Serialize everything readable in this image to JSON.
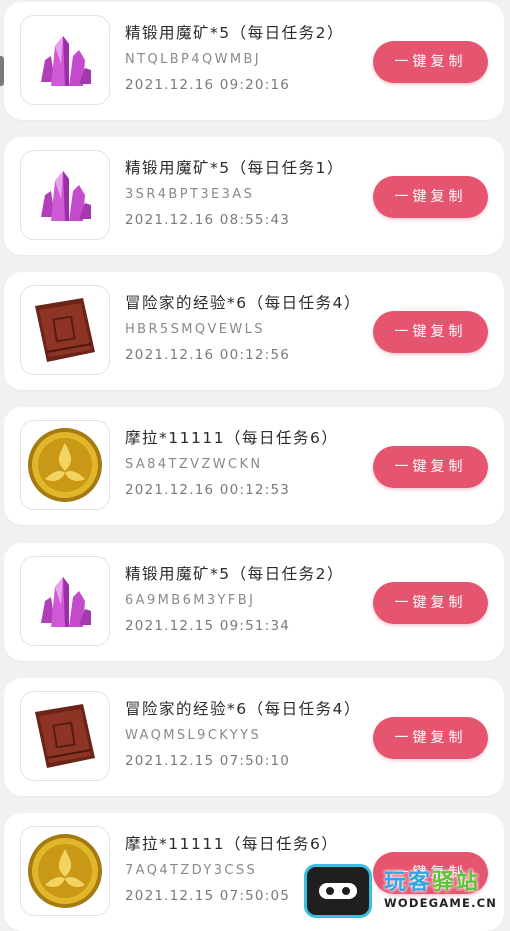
{
  "copy_label": "一键复制",
  "items": [
    {
      "title": "精锻用魔矿*5（每日任务2）",
      "code": "NTQLBP4QWMBJ",
      "time": "2021.12.16 09:20:16",
      "icon": "crystal-icon"
    },
    {
      "title": "精锻用魔矿*5（每日任务1）",
      "code": "3SR4BPT3E3AS",
      "time": "2021.12.16 08:55:43",
      "icon": "crystal-icon"
    },
    {
      "title": "冒险家的经验*6（每日任务4）",
      "code": "HBR5SMQVEWLS",
      "time": "2021.12.16 00:12:56",
      "icon": "book-icon"
    },
    {
      "title": "摩拉*11111（每日任务6）",
      "code": "SA84TZVZWCKN",
      "time": "2021.12.16 00:12:53",
      "icon": "coin-icon"
    },
    {
      "title": "精锻用魔矿*5（每日任务2）",
      "code": "6A9MB6M3YFBJ",
      "time": "2021.12.15 09:51:34",
      "icon": "crystal-icon"
    },
    {
      "title": "冒险家的经验*6（每日任务4）",
      "code": "WAQMSL9CKYYS",
      "time": "2021.12.15 07:50:10",
      "icon": "book-icon"
    },
    {
      "title": "摩拉*11111（每日任务6）",
      "code": "7AQ4TZDY3CSS",
      "time": "2021.12.15 07:50:05",
      "icon": "coin-icon"
    }
  ],
  "watermark": {
    "name_part1": "玩客",
    "name_part2": "驿站",
    "domain": "WODEGAME.CN"
  }
}
